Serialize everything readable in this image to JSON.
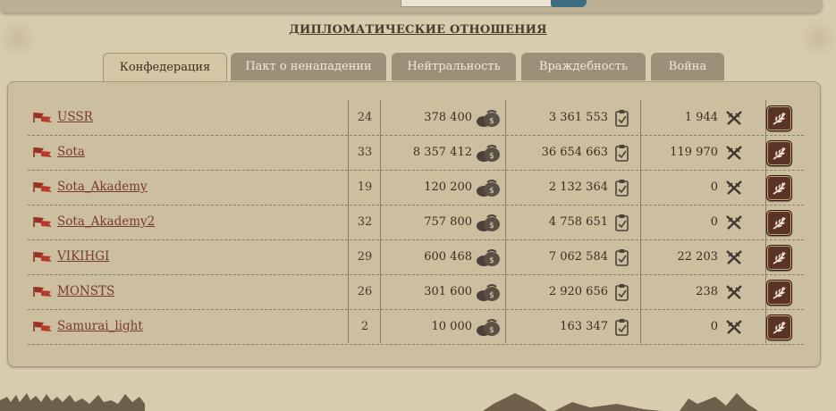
{
  "page_title": "ДИПЛОМАТИЧЕСКИЕ ОТНОШЕНИЯ",
  "tabs": [
    {
      "label": "Конфедерация",
      "active": true
    },
    {
      "label": "Пакт о ненападении",
      "active": false
    },
    {
      "label": "Нейтральность",
      "active": false
    },
    {
      "label": "Враждебность",
      "active": false
    },
    {
      "label": "Война",
      "active": false
    }
  ],
  "icons": {
    "alliance_flag": "flag-icon",
    "points": "money-bag-icon",
    "territory": "clipboard-icon",
    "kills": "crossed-swords-icon",
    "action": "laurel-icon"
  },
  "colors": {
    "link": "#7a3a2b",
    "active_tab": "#d4c6a5",
    "inactive_tab": "#9c9178",
    "action_button": "#5a3426"
  },
  "alliances": [
    {
      "name": "USSR",
      "members": "24",
      "points": "378 400",
      "territory": "3 361 553",
      "kills": "1 944"
    },
    {
      "name": "Sota",
      "members": "33",
      "points": "8 357 412",
      "territory": "36 654 663",
      "kills": "119 970"
    },
    {
      "name": "Sota_Akademy",
      "members": "19",
      "points": "120 200",
      "territory": "2 132 364",
      "kills": "0"
    },
    {
      "name": "Sota_Akademy2",
      "members": "32",
      "points": "757 800",
      "territory": "4 758 651",
      "kills": "0"
    },
    {
      "name": "VIKIHGI",
      "members": "29",
      "points": "600 468",
      "territory": "7 062 584",
      "kills": "22 203"
    },
    {
      "name": "MONSTS",
      "members": "26",
      "points": "301 600",
      "territory": "2 920 656",
      "kills": "238"
    },
    {
      "name": "Samurai_light",
      "members": "2",
      "points": "10 000",
      "territory": "163 347",
      "kills": "0"
    }
  ]
}
